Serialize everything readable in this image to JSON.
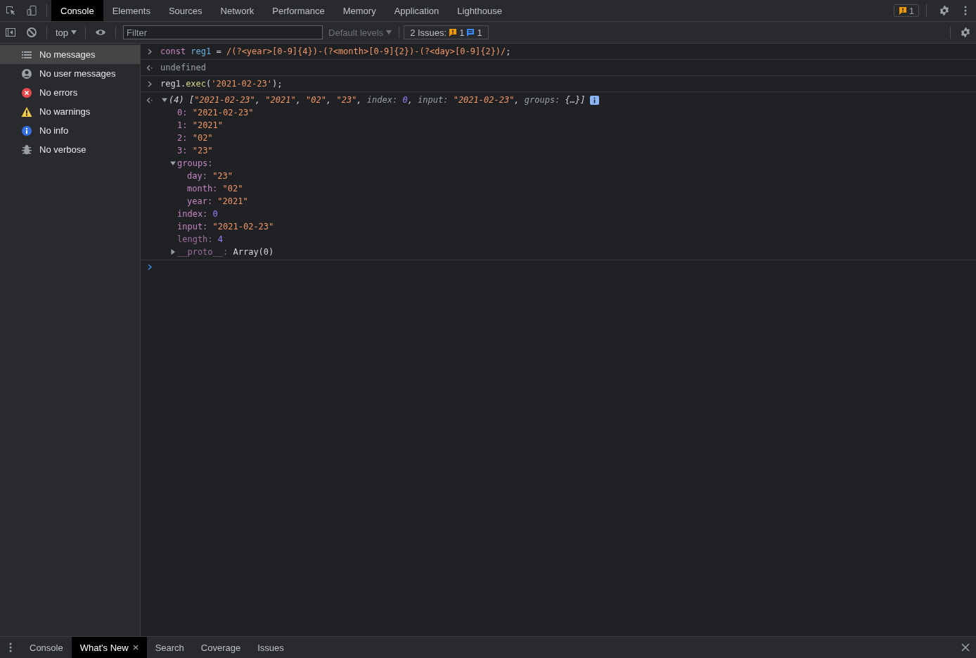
{
  "main_tabs": [
    {
      "label": "Console",
      "selected": true
    },
    {
      "label": "Elements",
      "selected": false
    },
    {
      "label": "Sources",
      "selected": false
    },
    {
      "label": "Network",
      "selected": false
    },
    {
      "label": "Performance",
      "selected": false
    },
    {
      "label": "Memory",
      "selected": false
    },
    {
      "label": "Application",
      "selected": false
    },
    {
      "label": "Lighthouse",
      "selected": false
    }
  ],
  "issues_badge": {
    "count": "1"
  },
  "toolbar": {
    "context": "top",
    "filter": {
      "placeholder": "Filter"
    },
    "levels": "Default levels",
    "issues": {
      "label": "2 Issues:",
      "warnings": "1",
      "infos": "1"
    }
  },
  "sidebar": {
    "items": [
      {
        "label": "No messages",
        "kind": "list",
        "selected": true
      },
      {
        "label": "No user messages",
        "kind": "user",
        "selected": false
      },
      {
        "label": "No errors",
        "kind": "error",
        "selected": false
      },
      {
        "label": "No warnings",
        "kind": "warning",
        "selected": false
      },
      {
        "label": "No info",
        "kind": "info",
        "selected": false
      },
      {
        "label": "No verbose",
        "kind": "bug",
        "selected": false
      }
    ]
  },
  "console": {
    "entries": [
      {
        "kind": "input",
        "tokens": [
          {
            "kind": "keyword",
            "text": "const "
          },
          {
            "kind": "variable",
            "text": "reg1"
          },
          {
            "kind": "plain",
            "text": " = "
          },
          {
            "kind": "string",
            "text": "/(?<year>[0-9]{4})-(?<month>[0-9]{2})-(?<day>[0-9]{2})/"
          },
          {
            "kind": "plain",
            "text": ";"
          }
        ]
      },
      {
        "kind": "result",
        "tokens": [
          {
            "kind": "dim",
            "text": "undefined"
          }
        ]
      },
      {
        "kind": "input",
        "tokens": [
          {
            "kind": "plain",
            "text": "reg1."
          },
          {
            "kind": "method",
            "text": "exec"
          },
          {
            "kind": "plain",
            "text": "("
          },
          {
            "kind": "string",
            "text": "'2021-02-23'"
          },
          {
            "kind": "plain",
            "text": ");"
          }
        ]
      },
      {
        "kind": "result",
        "expanded": true,
        "tokens": [
          {
            "kind": "plain",
            "text": "(4) ["
          },
          {
            "kind": "string",
            "text": "\"2021-02-23\""
          },
          {
            "kind": "plain",
            "text": ", "
          },
          {
            "kind": "string",
            "text": "\"2021\""
          },
          {
            "kind": "plain",
            "text": ", "
          },
          {
            "kind": "string",
            "text": "\"02\""
          },
          {
            "kind": "plain",
            "text": ", "
          },
          {
            "kind": "string",
            "text": "\"23\""
          },
          {
            "kind": "plain",
            "text": ", "
          },
          {
            "kind": "dim",
            "text": "index: "
          },
          {
            "kind": "number",
            "text": "0"
          },
          {
            "kind": "plain",
            "text": ", "
          },
          {
            "kind": "dim",
            "text": "input: "
          },
          {
            "kind": "string",
            "text": "\"2021-02-23\""
          },
          {
            "kind": "plain",
            "text": ", "
          },
          {
            "kind": "dim",
            "text": "groups: "
          },
          {
            "kind": "plain",
            "text": "{…}]"
          }
        ],
        "properties": [
          {
            "key": "0:",
            "own": true,
            "value": "\"2021-02-23\"",
            "kind": "string"
          },
          {
            "key": "1:",
            "own": true,
            "value": "\"2021\"",
            "kind": "string"
          },
          {
            "key": "2:",
            "own": true,
            "value": "\"02\"",
            "kind": "string"
          },
          {
            "key": "3:",
            "own": true,
            "value": "\"23\"",
            "kind": "string"
          },
          {
            "key": "groups:",
            "own": true,
            "expanded": true,
            "children": [
              {
                "key": "day:",
                "own": true,
                "value": "\"23\"",
                "kind": "string"
              },
              {
                "key": "month:",
                "own": true,
                "value": "\"02\"",
                "kind": "string"
              },
              {
                "key": "year:",
                "own": true,
                "value": "\"2021\"",
                "kind": "string"
              }
            ]
          },
          {
            "key": "index:",
            "own": true,
            "value": "0",
            "kind": "number"
          },
          {
            "key": "input:",
            "own": true,
            "value": "\"2021-02-23\"",
            "kind": "string"
          },
          {
            "key": "length:",
            "own": false,
            "value": "4",
            "kind": "number"
          },
          {
            "key": "__proto__:",
            "own": false,
            "expanded": false,
            "value": "Array(0)",
            "kind": "plain"
          }
        ]
      }
    ]
  },
  "drawer_tabs": [
    {
      "label": "Console",
      "selected": false,
      "closable": false
    },
    {
      "label": "What's New",
      "selected": true,
      "closable": true
    },
    {
      "label": "Search",
      "selected": false,
      "closable": false
    },
    {
      "label": "Coverage",
      "selected": false,
      "closable": false
    },
    {
      "label": "Issues",
      "selected": false,
      "closable": false
    }
  ]
}
